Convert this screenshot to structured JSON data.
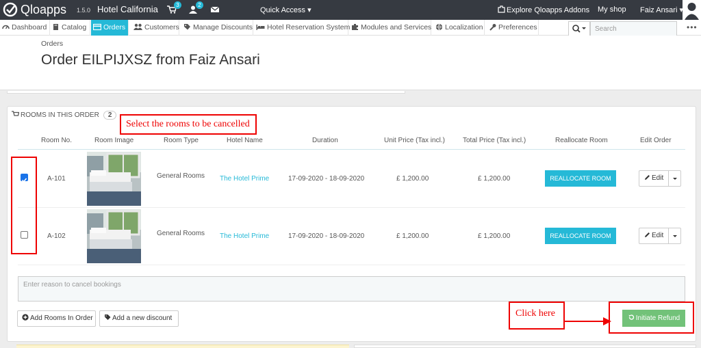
{
  "topbar": {
    "brand": "Qloapps",
    "version": "1.5.0",
    "shop_name": "Hotel California",
    "cart_badge": "3",
    "user_badge": "2",
    "quick_access": "Quick Access",
    "explore": "Explore Qloapps Addons",
    "my_shop": "My shop",
    "user_name": "Faiz Ansari"
  },
  "menu": {
    "items": [
      {
        "label": "Dashboard",
        "icon": "dashboard-icon"
      },
      {
        "label": "Catalog",
        "icon": "book-icon"
      },
      {
        "label": "Orders",
        "icon": "credit-card-icon",
        "active": true
      },
      {
        "label": "Customers",
        "icon": "users-icon"
      },
      {
        "label": "Manage Discounts",
        "icon": "tags-icon"
      },
      {
        "label": "Hotel Reservation System",
        "icon": "bed-icon"
      },
      {
        "label": "Modules and Services",
        "icon": "puzzle-icon"
      },
      {
        "label": "Localization",
        "icon": "globe-icon"
      },
      {
        "label": "Preferences",
        "icon": "wrench-icon"
      }
    ],
    "search_placeholder": "Search"
  },
  "header": {
    "breadcrumb": "Orders",
    "title": "Order EILPIJXSZ from Faiz Ansari"
  },
  "rooms_panel": {
    "heading": "ROOMS IN THIS ORDER",
    "count": "2",
    "columns": [
      "Room No.",
      "Room Image",
      "Room Type",
      "Hotel Name",
      "Duration",
      "Unit Price (Tax incl.)",
      "Total Price (Tax incl.)",
      "Reallocate Room",
      "Edit Order"
    ],
    "rows": [
      {
        "checked": true,
        "room_no": "A-101",
        "room_type": "General Rooms",
        "hotel": "The Hotel Prime",
        "duration": "17-09-2020 -  18-09-2020",
        "unit_price": "£ 1,200.00",
        "total_price": "£ 1,200.00",
        "reallocate": "REALLOCATE ROOM",
        "edit": "Edit"
      },
      {
        "checked": false,
        "room_no": "A-102",
        "room_type": "General Rooms",
        "hotel": "The Hotel Prime",
        "duration": "17-09-2020 -  18-09-2020",
        "unit_price": "£ 1,200.00",
        "total_price": "£ 1,200.00",
        "reallocate": "REALLOCATE ROOM",
        "edit": "Edit"
      }
    ],
    "reason_placeholder": "Enter reason to cancel bookings",
    "add_rooms": "Add Rooms In Order",
    "add_discount": "Add a new discount",
    "initiate_refund": "Initiate Refund"
  },
  "annotations": {
    "select_rooms": "Select the rooms to be cancelled",
    "click_here": "Click here",
    "color": "#e00000"
  },
  "colors": {
    "accent": "#25b9d7",
    "topbar": "#363a41",
    "refund_green": "#72c279"
  }
}
